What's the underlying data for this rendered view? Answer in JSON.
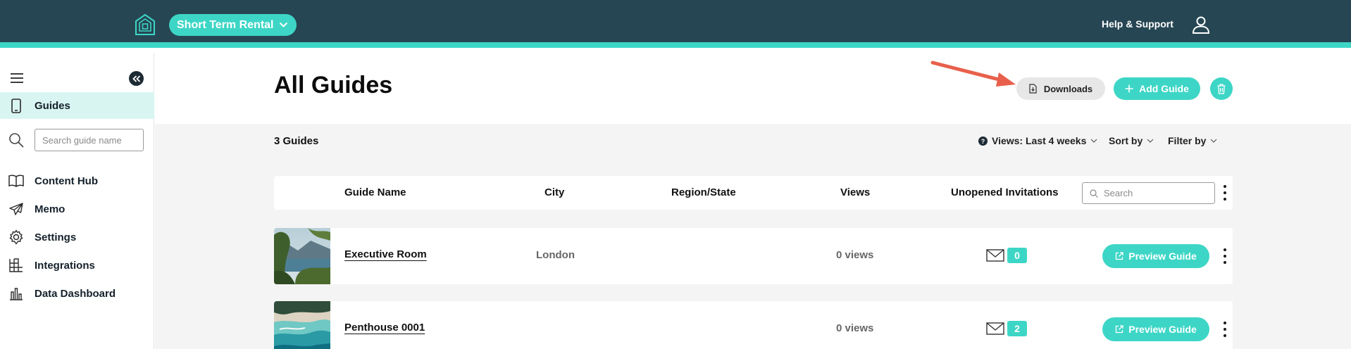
{
  "header": {
    "property_type": "Short Term Rental",
    "help_label": "Help & Support",
    "logo_icon": "house-logo-icon",
    "user_icon": "user-icon"
  },
  "sidebar": {
    "collapse_icon": "double-chevron-left-icon",
    "search_placeholder": "Search guide name",
    "items": [
      {
        "label": "Guides",
        "icon": "phone-icon",
        "active": true
      },
      {
        "label": "Content Hub",
        "icon": "book-icon"
      },
      {
        "label": "Memo",
        "icon": "paper-plane-icon"
      },
      {
        "label": "Settings",
        "icon": "gear-icon"
      },
      {
        "label": "Integrations",
        "icon": "grid-icon"
      },
      {
        "label": "Data Dashboard",
        "icon": "bar-chart-icon"
      }
    ]
  },
  "page": {
    "title": "All Guides",
    "downloads_label": "Downloads",
    "add_guide_label": "Add Guide"
  },
  "toolbar": {
    "count": "3 Guides",
    "views_filter": "Views: Last 4 weeks",
    "sort_label": "Sort by",
    "filter_label": "Filter by"
  },
  "table": {
    "columns": [
      "Guide Name",
      "City",
      "Region/State",
      "Views",
      "Unopened Invitations"
    ],
    "search_placeholder": "Search",
    "preview_label": "Preview Guide",
    "rows": [
      {
        "name": "Executive Room",
        "city": "London",
        "region": "",
        "views": "0 views",
        "invitations": "0"
      },
      {
        "name": "Penthouse 0001",
        "city": "",
        "region": "",
        "views": "0 views",
        "invitations": "2"
      }
    ]
  },
  "colors": {
    "header_bg": "#264653",
    "accent": "#3dd6c6",
    "active_nav_bg": "#d9f5f2",
    "arrow": "#e8604c"
  }
}
